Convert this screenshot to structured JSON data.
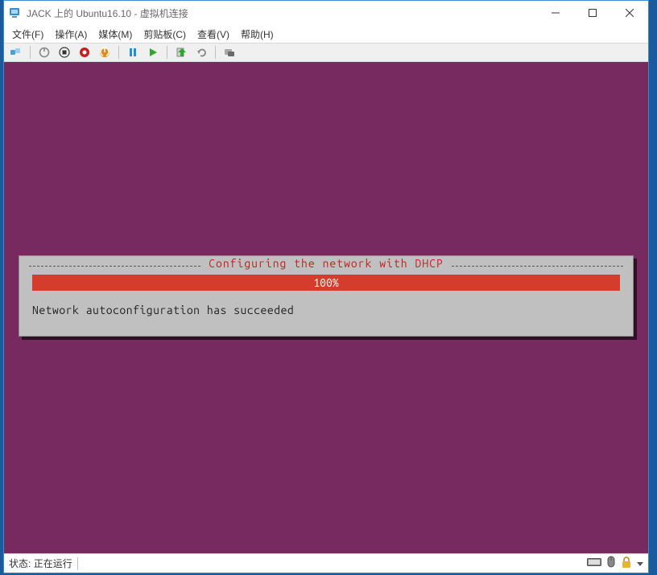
{
  "titlebar": {
    "title": "JACK 上的 Ubuntu16.10 - 虚拟机连接"
  },
  "menu": {
    "file": "文件(F)",
    "action": "操作(A)",
    "media": "媒体(M)",
    "clipboard": "剪贴板(C)",
    "view": "查看(V)",
    "help": "帮助(H)"
  },
  "toolbar_icons": {
    "ctrl_alt_del": "ctrl-alt-del-icon",
    "shutdown": "shutdown-icon",
    "stop": "stop-icon",
    "turn_off": "turn-off-icon",
    "power": "power-icon",
    "pause": "pause-icon",
    "start": "start-icon",
    "checkpoint": "checkpoint-icon",
    "revert": "revert-icon",
    "share": "share-icon"
  },
  "dialog": {
    "title": "Configuring the network with DHCP",
    "progress_label": "100%",
    "message": "Network autoconfiguration has succeeded"
  },
  "statusbar": {
    "label": "状态:",
    "value": "正在运行"
  },
  "colors": {
    "vm_bg": "#772a5f",
    "progress": "#d43c2b",
    "dlg_title": "#c42020"
  }
}
